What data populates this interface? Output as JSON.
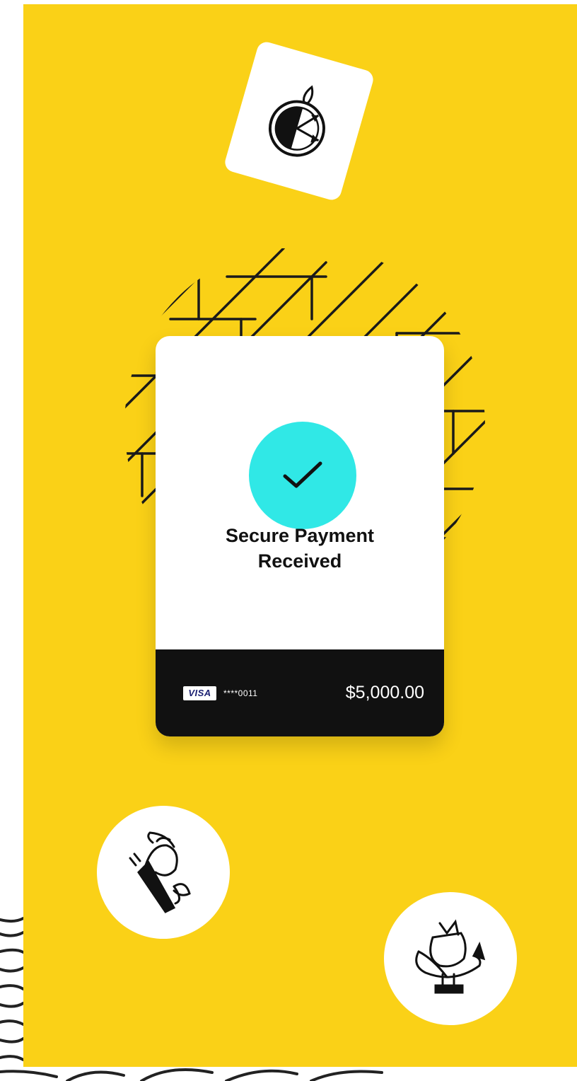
{
  "payment": {
    "title_line1": "Secure Payment",
    "title_line2": "Received",
    "card_brand": "VISA",
    "card_masked": "****0011",
    "amount": "$5,000.00"
  },
  "icons": {
    "check": "check-icon",
    "stopwatch": "fire-stopwatch-icon",
    "shoe": "winged-shoe-icon",
    "trophy": "trophy-banner-icon"
  },
  "colors": {
    "background": "#FAD117",
    "accent": "#30E8E6",
    "footer": "#111111",
    "visa": "#1A1F71"
  }
}
